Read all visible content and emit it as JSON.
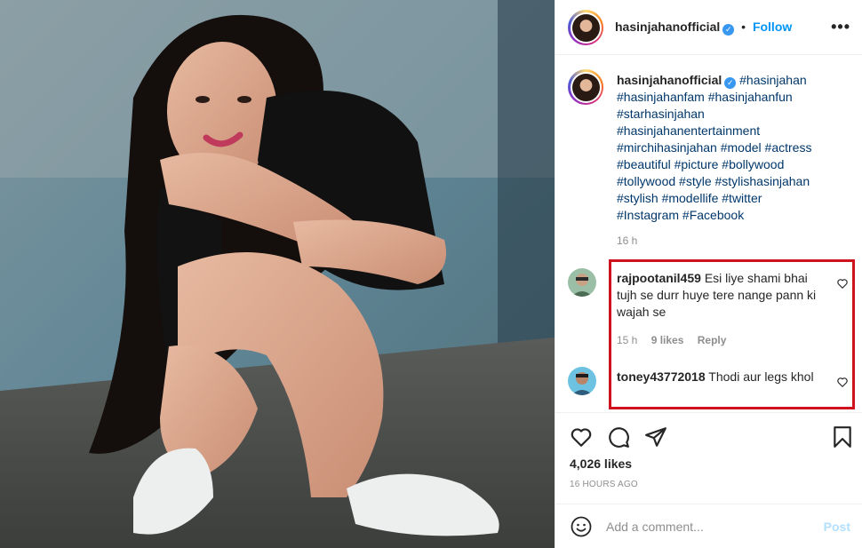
{
  "post": {
    "author": "hasinjahanofficial",
    "follow_label": "Follow",
    "header_dot": "•",
    "more_label": "•••"
  },
  "caption": {
    "author": "hasinjahanofficial",
    "lines": [
      "#hasinjahan",
      "#hasinjahanfam #hasinjahanfun",
      "#starhasinjahan",
      "#hasinjahanentertainment",
      "#mirchihasinjahan #model #actress",
      "#beautiful #picture #bollywood",
      "#tollywood #style #stylishasinjahan",
      "#stylish #modellife #twitter",
      "#Instagram #Facebook"
    ],
    "time": "16 h"
  },
  "comments": [
    {
      "user": "rajpootanil459",
      "text": "Esi liye shami bhai tujh se durr huye tere nange pann ki wajah se",
      "time": "15 h",
      "likes": "9 likes",
      "reply": "Reply"
    },
    {
      "user": "toney43772018",
      "text": "Thodi aur legs khol"
    }
  ],
  "stats": {
    "likes": "4,026 likes",
    "ago": "16 HOURS AGO"
  },
  "add_comment": {
    "placeholder": "Add a comment...",
    "post_label": "Post"
  },
  "colors": {
    "accent": "#0095f6",
    "highlight_box": "#d0121f",
    "hashtag": "#00376b",
    "muted": "#8e8e8e"
  },
  "icons": [
    "verified-badge-icon",
    "more-options-icon",
    "heart-icon",
    "comment-icon",
    "share-icon",
    "bookmark-icon",
    "emoji-icon"
  ]
}
